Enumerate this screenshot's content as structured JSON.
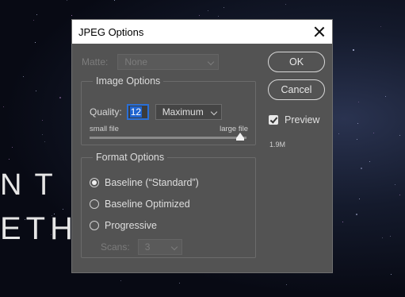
{
  "background": {
    "text_line1": "NT S",
    "text_line2": "ETHI"
  },
  "dialog": {
    "title": "JPEG Options",
    "matte": {
      "label": "Matte:",
      "value": "None"
    },
    "image_options": {
      "legend": "Image Options",
      "quality_label": "Quality:",
      "quality_value": "12",
      "quality_preset": "Maximum",
      "slider_min_label": "small file",
      "slider_max_label": "large file",
      "slider_level": 0.96
    },
    "format_options": {
      "legend": "Format Options",
      "options": [
        "Baseline (“Standard”)",
        "Baseline Optimized",
        "Progressive"
      ],
      "selected_index": 0,
      "scans_label": "Scans:",
      "scans_value": "3"
    },
    "buttons": {
      "ok": "OK",
      "cancel": "Cancel"
    },
    "preview": {
      "label": "Preview",
      "checked": true
    },
    "file_size": "1.9M"
  }
}
